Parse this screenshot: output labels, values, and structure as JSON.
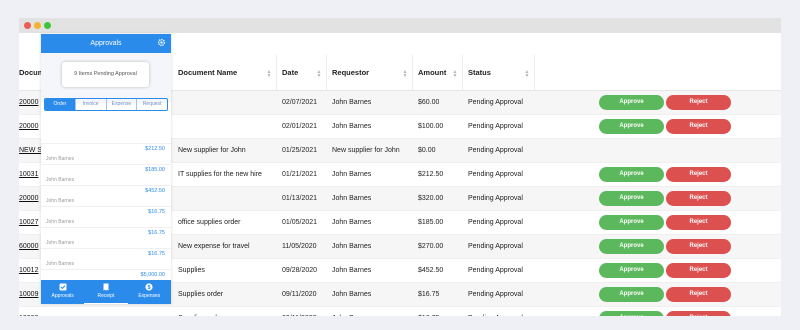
{
  "table": {
    "headers": {
      "document_name": "Document Name",
      "date": "Date",
      "requestor": "Requestor",
      "amount": "Amount",
      "status": "Status"
    },
    "rows": [
      {
        "id": "20000",
        "doc": "",
        "date": "02/07/2021",
        "req": "John Barnes",
        "amt": "$60.00",
        "status": "Pending Approval",
        "actions": true,
        "shade": true
      },
      {
        "id": "20000",
        "doc": "",
        "date": "02/01/2021",
        "req": "John Barnes",
        "amt": "$100.00",
        "status": "Pending Approval",
        "actions": true,
        "shade": false
      },
      {
        "id": "NEW S",
        "doc": "New supplier for John",
        "date": "01/25/2021",
        "req": "New supplier for John",
        "amt": "$0.00",
        "status": "Pending Approval",
        "actions": false,
        "shade": true
      },
      {
        "id": "10031",
        "doc": "IT supplies for the new hire",
        "date": "01/21/2021",
        "req": "John Barnes",
        "amt": "$212.50",
        "status": "Pending Approval",
        "actions": true,
        "shade": false
      },
      {
        "id": "20000",
        "doc": "",
        "date": "01/13/2021",
        "req": "John Barnes",
        "amt": "$320.00",
        "status": "Pending Approval",
        "actions": true,
        "shade": true
      },
      {
        "id": "10027",
        "doc": "office supplies order",
        "date": "01/05/2021",
        "req": "John Barnes",
        "amt": "$185.00",
        "status": "Pending Approval",
        "actions": true,
        "shade": false
      },
      {
        "id": "60000",
        "doc": "New expense for travel",
        "date": "11/05/2020",
        "req": "John Barnes",
        "amt": "$270.00",
        "status": "Pending Approval",
        "actions": true,
        "shade": true
      },
      {
        "id": "10012",
        "doc": "Supplies",
        "date": "09/28/2020",
        "req": "John Barnes",
        "amt": "$452.50",
        "status": "Pending Approval",
        "actions": true,
        "shade": false
      },
      {
        "id": "10009",
        "doc": "Supplies order",
        "date": "09/11/2020",
        "req": "John Barnes",
        "amt": "$16.75",
        "status": "Pending Approval",
        "actions": true,
        "shade": true
      },
      {
        "id": "10009",
        "doc": "Supplies order",
        "date": "09/11/2020",
        "req": "John Barnes",
        "amt": "$16.75",
        "status": "Pending Approval",
        "actions": true,
        "shade": false
      }
    ],
    "approve_label": "Approve",
    "reject_label": "Reject",
    "first_col_header": "Docum"
  },
  "mobile": {
    "title": "Approvals",
    "pending_text": "9 Items Pending Approval",
    "tabs": [
      "Order",
      "Invoice",
      "Expense",
      "Request"
    ],
    "active_tab": 0,
    "items": [
      {
        "amount": "$212.50",
        "name": "John Barnes"
      },
      {
        "amount": "$185.00",
        "name": "John Barnes"
      },
      {
        "amount": "$452.50",
        "name": "John Barnes"
      },
      {
        "amount": "$16.75",
        "name": "John Barnes"
      },
      {
        "amount": "$16.75",
        "name": "John Barnes"
      },
      {
        "amount": "$16.75",
        "name": "John Barnes"
      },
      {
        "amount": "$5,000.00",
        "name": "John Barnes"
      }
    ],
    "footer": [
      {
        "label": "Approvals",
        "icon": "check-square-icon"
      },
      {
        "label": "Receipt",
        "icon": "receipt-icon"
      },
      {
        "label": "Expenses",
        "icon": "dollar-icon"
      }
    ],
    "active_footer": 1
  },
  "colors": {
    "approve": "#5cb85c",
    "reject": "#dc5050",
    "accent": "#2a8bea"
  }
}
